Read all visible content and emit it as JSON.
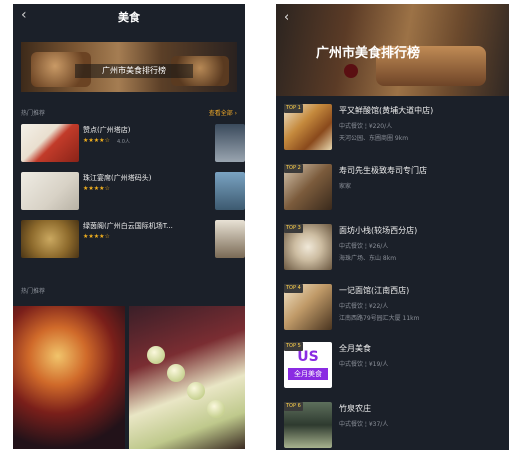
{
  "left_screen": {
    "nav": {
      "back_glyph": "‹",
      "title": "美食"
    },
    "banner": {
      "title": "广州市美食排行榜"
    },
    "hot_shops": {
      "section_label": "热门推荐",
      "more_label": "查看全部 ›",
      "items": [
        {
          "name": "赞点(广州塔店)",
          "stars": "★★★★☆",
          "rating_note": "4.0人",
          "meta": ""
        },
        {
          "name": "珠江宴席(广州塔码头)",
          "stars": "★★★★☆",
          "rating_note": "",
          "meta": ""
        },
        {
          "name": "绿茵阁(广州白云国际机场T...",
          "stars": "★★★★☆",
          "rating_note": "",
          "meta": ""
        }
      ]
    },
    "section2_label": "热门推荐"
  },
  "right_screen": {
    "nav": {
      "back_glyph": "‹"
    },
    "banner": {
      "title": "广州市美食排行榜"
    },
    "ranking": [
      {
        "badge": "TOP 1",
        "name": "平又鲜酸馆(黄埔大道中店)",
        "cat": "中式餐饮 ¦ ¥220/人",
        "loc": "天河公园、东圃商圈 9km"
      },
      {
        "badge": "TOP 2",
        "name": "寿司先生极致寿司专门店",
        "cat": "家家",
        "loc": ""
      },
      {
        "badge": "TOP 3",
        "name": "面坊小栈(较场西分店)",
        "cat": "中式餐饮 ¦ ¥26/人",
        "loc": "海珠广场、东山 8km"
      },
      {
        "badge": "TOP 4",
        "name": "一记面馆(江南西店)",
        "cat": "中式餐饮 ¦ ¥22/人",
        "loc": "江南西路79号园汇大厦 11km"
      },
      {
        "badge": "TOP 5",
        "name": "全月美食",
        "cat": "中式餐饮 ¦ ¥19/人",
        "loc": ""
      },
      {
        "badge": "TOP 6",
        "name": "竹泉农庄",
        "cat": "中式餐饮 ¦ ¥37/人",
        "loc": ""
      }
    ],
    "logo_item": {
      "mark": "US",
      "text": "全月美食"
    }
  }
}
